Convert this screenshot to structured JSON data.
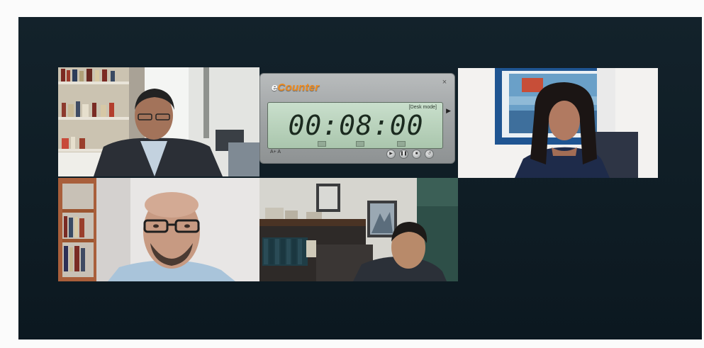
{
  "ecounter": {
    "logo_e": "e",
    "logo_rest": "Counter",
    "time": "00:08:00",
    "mode_label": "[Desk mode]",
    "font_size_label": "A+ A",
    "close_icon": "×",
    "controls": [
      "play",
      "pause",
      "stop",
      "reset"
    ]
  },
  "participants": [
    {
      "id": "participant-1",
      "description": "man in dark suit in library office"
    },
    {
      "id": "participant-2",
      "description": "woman in dark blouse in office"
    },
    {
      "id": "participant-3",
      "description": "bald man with glasses"
    },
    {
      "id": "participant-4",
      "description": "man in dark suit with picture frames behind"
    }
  ],
  "colors": {
    "background": "#13222b",
    "timer_display": "#b8d4bb",
    "logo_accent": "#ef8a1d"
  }
}
